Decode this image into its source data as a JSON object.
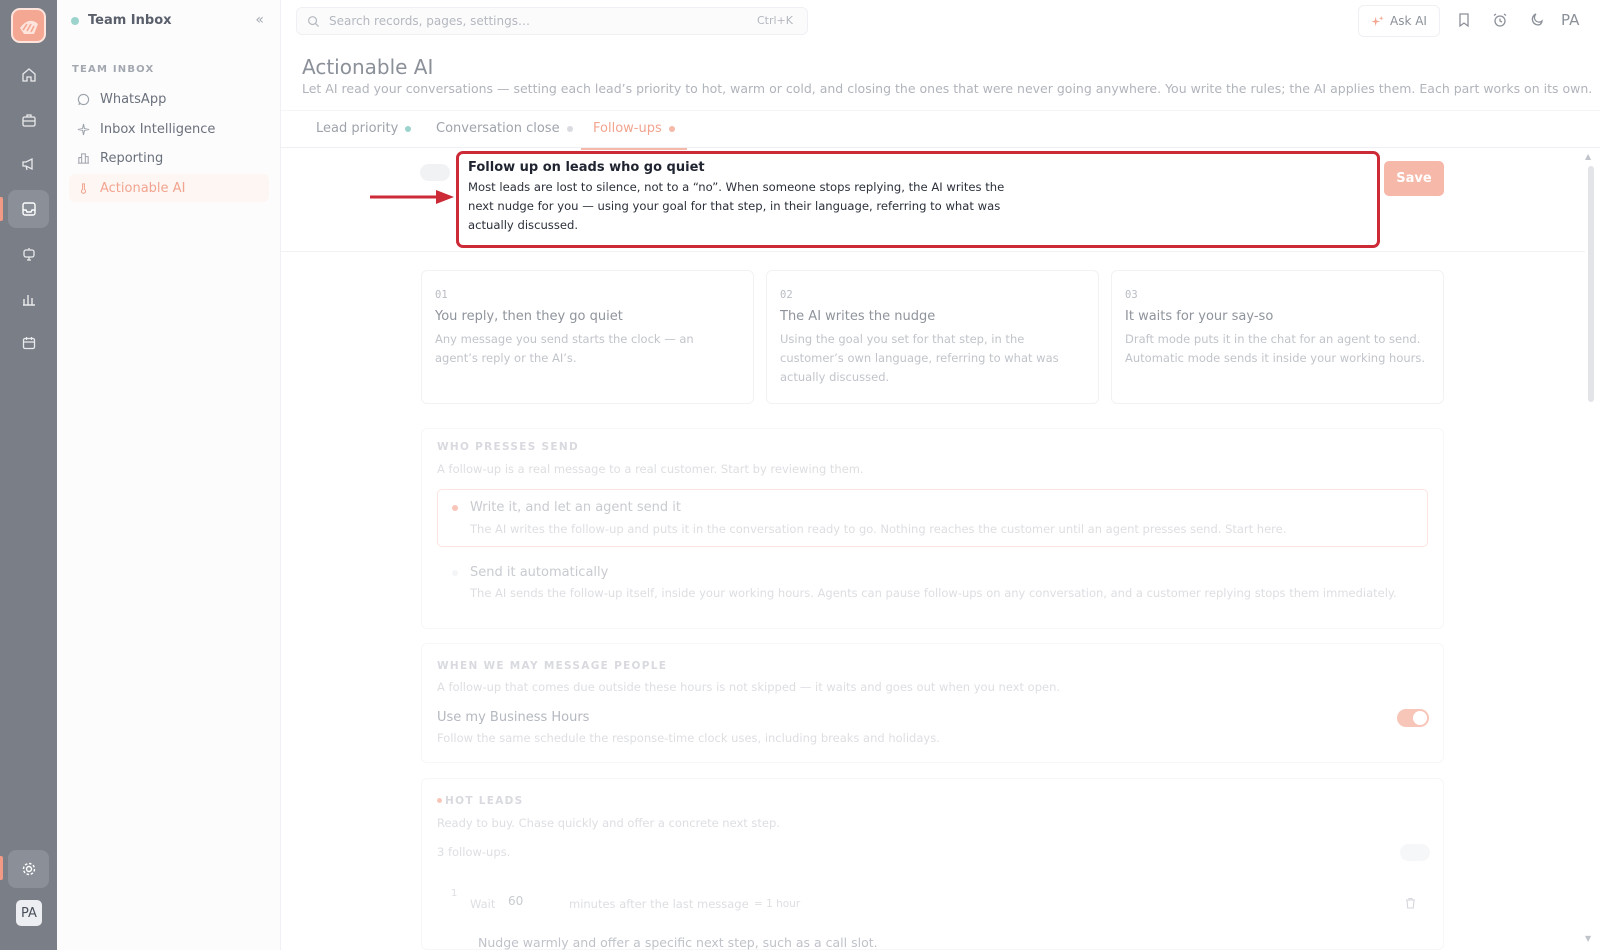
{
  "sidebar": {
    "team_title": "Team Inbox",
    "section_label": "TEAM INBOX",
    "items": [
      {
        "label": "WhatsApp"
      },
      {
        "label": "Inbox Intelligence"
      },
      {
        "label": "Reporting"
      },
      {
        "label": "Actionable AI"
      }
    ]
  },
  "rail": {
    "avatar": "PA"
  },
  "topbar": {
    "search_placeholder": "Search records, pages, settings…",
    "search_shortcut": "Ctrl+K",
    "ask_ai": "Ask AI",
    "user_initials": "PA"
  },
  "page": {
    "title": "Actionable AI",
    "subtitle": "Let AI read your conversations — setting each lead’s priority to hot, warm or cold, and closing the ones that were never going anywhere. You write the rules; the AI applies them. Each part works on its own."
  },
  "tabs": [
    {
      "label": "Lead priority",
      "dot_color": "#9cd4cd"
    },
    {
      "label": "Conversation close",
      "dot_color": "#d9dbe0"
    },
    {
      "label": "Follow-ups",
      "dot_color": "#f6b8a8",
      "active": true
    }
  ],
  "callout": {
    "title": "Follow up on leads who go quiet",
    "body": "Most leads are lost to silence, not to a “no”. When someone stops replying, the AI writes the next nudge for you — using your goal for that step, in their language, referring to what was actually discussed."
  },
  "save_label": "Save",
  "steps": [
    {
      "num": "01",
      "title": "You reply, then they go quiet",
      "desc": "Any message you send starts the clock — an agent’s reply or the AI’s."
    },
    {
      "num": "02",
      "title": "The AI writes the nudge",
      "desc": "Using the goal you set for that step, in the customer’s own language, referring to what was actually discussed."
    },
    {
      "num": "03",
      "title": "It waits for your say-so",
      "desc": "Draft mode puts it in the chat for an agent to send. Automatic mode sends it inside your working hours."
    }
  ],
  "who_sends": {
    "label": "WHO PRESSES SEND",
    "desc": "A follow-up is a real message to a real customer. Start by reviewing them.",
    "options": [
      {
        "title": "Write it, and let an agent send it",
        "desc": "The AI writes the follow-up and puts it in the conversation ready to go. Nothing reaches the customer until an agent presses send. Start here."
      },
      {
        "title": "Send it automatically",
        "desc": "The AI sends the follow-up itself, inside your working hours. Agents can pause follow-ups on any conversation, and a customer replying stops them immediately."
      }
    ]
  },
  "when_message": {
    "label": "WHEN WE MAY MESSAGE PEOPLE",
    "desc": "A follow-up that comes due outside these hours is not skipped — it waits and goes out when you next open.",
    "setting_title": "Use my Business Hours",
    "setting_desc": "Follow the same schedule the response-time clock uses, including breaks and holidays.",
    "toggle_on": true
  },
  "hot_leads": {
    "label": "HOT LEADS",
    "desc": "Ready to buy. Chase quickly and offer a concrete next step.",
    "count": "3 follow-ups.",
    "step_index": "1",
    "wait_label": "Wait",
    "wait_value": "60",
    "wait_suffix": "minutes after the last message",
    "wait_hint": "= 1 hour",
    "nudge_text": "Nudge warmly and offer a specific next step, such as a call slot."
  }
}
